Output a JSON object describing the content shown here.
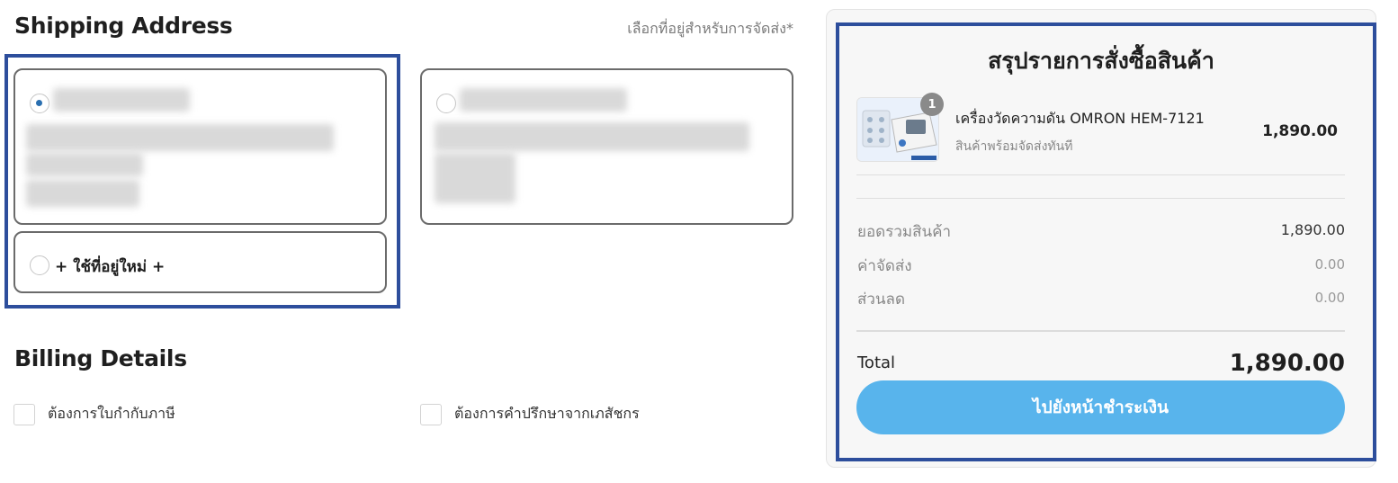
{
  "shipping": {
    "title": "Shipping Address",
    "hint": "เลือกที่อยู่สำหรับการจัดส่ง*",
    "new_address_label": "+ ใช้ที่อยู่ใหม่ +",
    "selected_index": 0
  },
  "billing": {
    "title": "Billing Details",
    "options": [
      {
        "label": "ต้องการใบกำกับภาษี"
      },
      {
        "label": "ต้องการคำปรึกษาจากเภสัชกร"
      }
    ]
  },
  "summary": {
    "title": "สรุปรายการสั่งซื้อสินค้า",
    "item": {
      "name": "เครื่องวัดความดัน OMRON HEM-7121",
      "subtitle": "สินค้าพร้อมจัดส่งทันที",
      "price": "1,890.00",
      "quantity": "1"
    },
    "lines": [
      {
        "label": "ยอดรวมสินค้า",
        "value": "1,890.00"
      },
      {
        "label": "ค่าจัดส่ง",
        "value": "0.00"
      },
      {
        "label": "ส่วนลด",
        "value": "0.00"
      }
    ],
    "total_label": "Total",
    "total_value": "1,890.00",
    "checkout_label": "ไปยังหน้าชำระเงิน"
  },
  "colors": {
    "accent": "#58b4ec",
    "highlight_border": "#2d4e9c",
    "radio_selected": "#2a6fb0"
  }
}
